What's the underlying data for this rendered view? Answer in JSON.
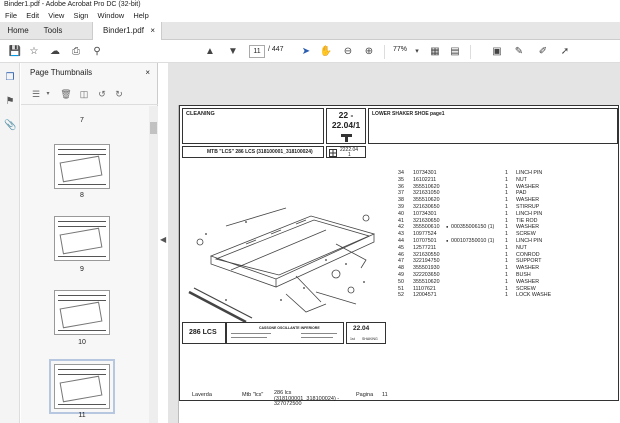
{
  "window": {
    "title": "Binder1.pdf - Adobe Acrobat Pro DC (32-bit)"
  },
  "menu": [
    "File",
    "Edit",
    "View",
    "Sign",
    "Window",
    "Help"
  ],
  "tabs": {
    "home": "Home",
    "tools": "Tools",
    "doc": "Binder1.pdf",
    "close": "×"
  },
  "toolbar": {
    "current_page": "11",
    "total_pages": "/ 447",
    "zoom": "77%"
  },
  "sidebar": {
    "panel_title": "Page Thumbnails",
    "close": "×",
    "thumbs": [
      {
        "label": "7",
        "selected": false
      },
      {
        "label": "8",
        "selected": false
      },
      {
        "label": "9",
        "selected": false
      },
      {
        "label": "10",
        "selected": false
      },
      {
        "label": "11",
        "selected": true
      }
    ]
  },
  "document": {
    "title_left": "CLEANING",
    "page_ref": "22 -",
    "page_ref_num": "22.04/1",
    "title_right": "LOWER SHAKER SHOE  page1",
    "model_line": "MTB \"LCS\" 286 LCS (318100001_318100024)",
    "small_ref": "2222.04",
    "small_ref_num": "1",
    "model_badge": "286 LCS",
    "mid_caption": "CASSONE OSCILLANTE INFERIORE",
    "section_badge": "22.04",
    "section_sub_a": "1st",
    "section_sub_b": "SHAKING",
    "footer_brand": "Laverda",
    "footer_model": "Mtb \"lcs\"",
    "footer_range": "286 lcs (318100001_318100024) - 327072500",
    "footer_pagina": "Pagina",
    "footer_pagenum": "11",
    "parts": [
      {
        "pos": "34",
        "code": "10734301",
        "alt": "",
        "qty": "1",
        "desc": "LINCH PIN"
      },
      {
        "pos": "35",
        "code": "16102211",
        "alt": "",
        "qty": "1",
        "desc": "NUT"
      },
      {
        "pos": "36",
        "code": "355510620",
        "alt": "",
        "qty": "1",
        "desc": "WASHER"
      },
      {
        "pos": "37",
        "code": "321631050",
        "alt": "",
        "qty": "1",
        "desc": "PAD"
      },
      {
        "pos": "38",
        "code": "355510620",
        "alt": "",
        "qty": "1",
        "desc": "WASHER"
      },
      {
        "pos": "39",
        "code": "321630650",
        "alt": "",
        "qty": "1",
        "desc": "STIRRUP"
      },
      {
        "pos": "40",
        "code": "10734301",
        "alt": "",
        "qty": "1",
        "desc": "LINCH PIN"
      },
      {
        "pos": "41",
        "code": "321630650",
        "alt": "",
        "qty": "1",
        "desc": "TIE ROD"
      },
      {
        "pos": "42",
        "code": "355500610",
        "alt": "000355006150 (1)",
        "qty": "1",
        "desc": "WASHER"
      },
      {
        "pos": "43",
        "code": "10977524",
        "alt": "",
        "qty": "1",
        "desc": "SCREW"
      },
      {
        "pos": "44",
        "code": "10707501",
        "alt": "000107350010 (1)",
        "qty": "1",
        "desc": "LINCH PIN"
      },
      {
        "pos": "45",
        "code": "12577211",
        "alt": "",
        "qty": "1",
        "desc": "NUT"
      },
      {
        "pos": "46",
        "code": "321630550",
        "alt": "",
        "qty": "1",
        "desc": "CONROD"
      },
      {
        "pos": "47",
        "code": "322194750",
        "alt": "",
        "qty": "1",
        "desc": "SUPPORT"
      },
      {
        "pos": "48",
        "code": "355501930",
        "alt": "",
        "qty": "1",
        "desc": "WASHER"
      },
      {
        "pos": "49",
        "code": "322203650",
        "alt": "",
        "qty": "1",
        "desc": "BUSH"
      },
      {
        "pos": "50",
        "code": "355510620",
        "alt": "",
        "qty": "1",
        "desc": "WASHER"
      },
      {
        "pos": "51",
        "code": "11107621",
        "alt": "",
        "qty": "1",
        "desc": "SCREW"
      },
      {
        "pos": "52",
        "code": "12004571",
        "alt": "",
        "qty": "1",
        "desc": "LOCK WASHE"
      }
    ]
  },
  "icon_color": "#333333",
  "accent_color": "#2a5db0"
}
